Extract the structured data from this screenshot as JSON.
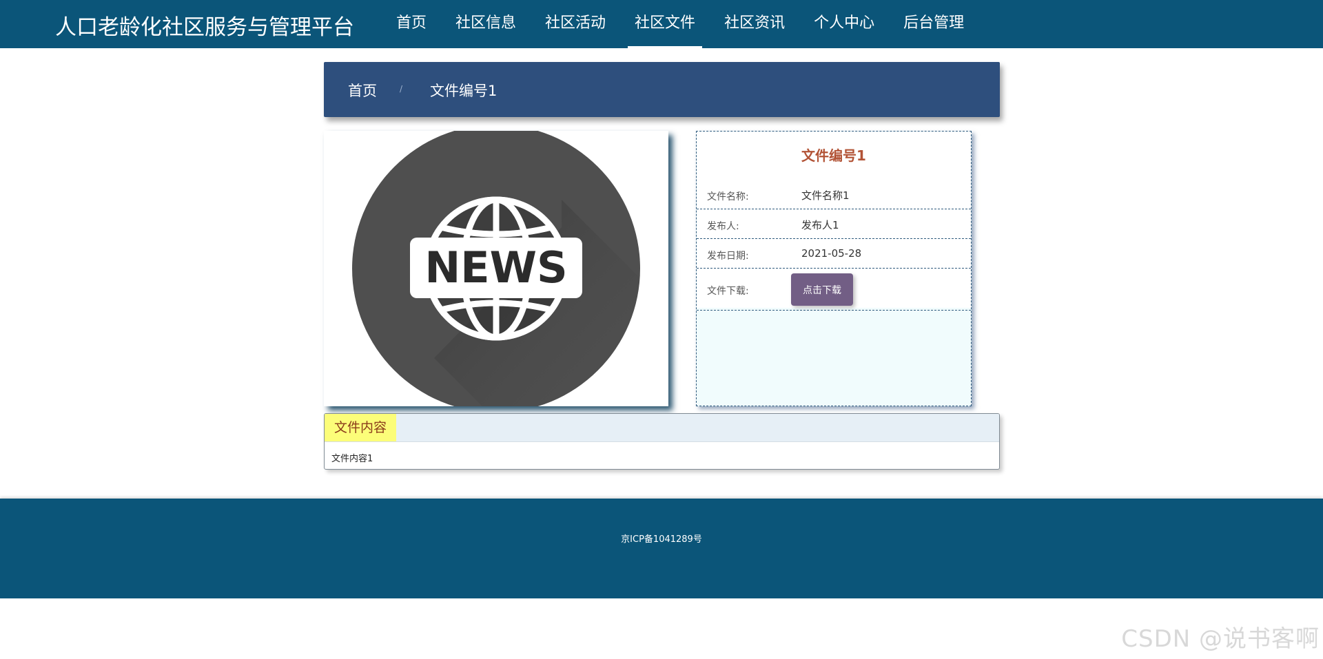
{
  "header": {
    "site_title": "人口老龄化社区服务与管理平台",
    "nav": [
      {
        "label": "首页"
      },
      {
        "label": "社区信息"
      },
      {
        "label": "社区活动"
      },
      {
        "label": "社区文件",
        "active": true
      },
      {
        "label": "社区资讯"
      },
      {
        "label": "个人中心"
      },
      {
        "label": "后台管理"
      }
    ]
  },
  "breadcrumb": {
    "home": "首页",
    "separator": "/",
    "current": "文件编号1"
  },
  "image": {
    "text": "NEWS",
    "icon": "globe-news-icon"
  },
  "info": {
    "title": "文件编号1",
    "rows": [
      {
        "label": "文件名称:",
        "value": "文件名称1"
      },
      {
        "label": "发布人:",
        "value": "发布人1"
      },
      {
        "label": "发布日期:",
        "value": "2021-05-28"
      }
    ],
    "download_label": "文件下载:",
    "download_button": "点击下载"
  },
  "content": {
    "tab_label": "文件内容",
    "body": "文件内容1"
  },
  "footer": {
    "icp": "京ICP备1041289号"
  },
  "watermark": "CSDN @说书客啊",
  "colors": {
    "header_bg": "#0b5579",
    "breadcrumb_bg": "#2e4f7d",
    "title_accent": "#b25336",
    "button_bg": "#725e85",
    "tab_highlight": "#fcfd79"
  }
}
